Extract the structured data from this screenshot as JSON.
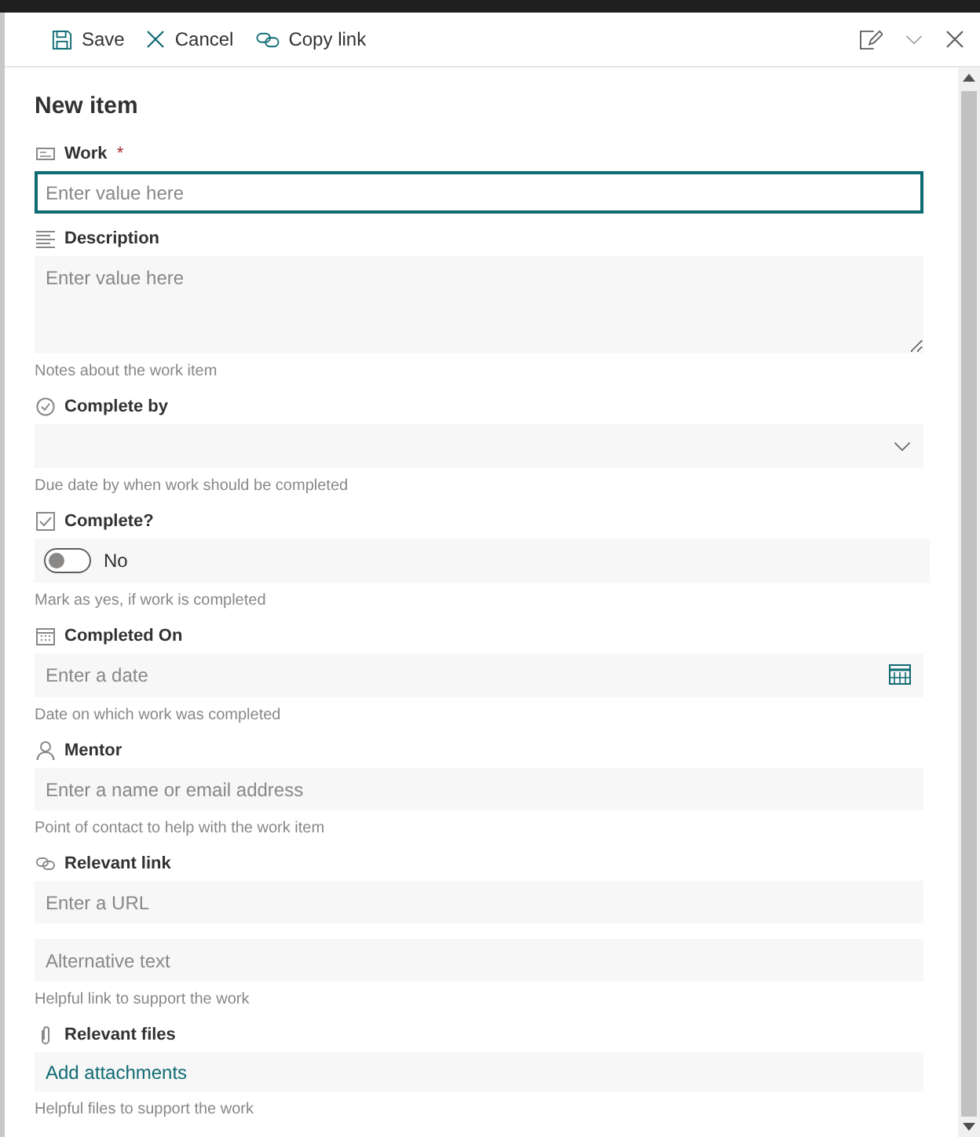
{
  "toolbar": {
    "buttons": [
      {
        "kind": "save",
        "label": "Save"
      },
      {
        "kind": "cancel",
        "label": "Cancel"
      },
      {
        "kind": "copy_link",
        "label": "Copy link"
      }
    ]
  },
  "form": {
    "title": "New item",
    "fields": [
      {
        "kind": "text",
        "label": "Work",
        "required_mark": "*",
        "placeholder": "Enter value here",
        "focused": true
      },
      {
        "kind": "multiline",
        "label": "Description",
        "placeholder": "Enter value here",
        "help": "Notes about the work item"
      },
      {
        "kind": "choice",
        "label": "Complete by",
        "help": "Due date by when work should be completed"
      },
      {
        "kind": "boolean",
        "label": "Complete?",
        "on": false,
        "value": "No",
        "help": "Mark as yes, if work is completed"
      },
      {
        "kind": "date",
        "label": "Completed On",
        "placeholder": "Enter a date",
        "help": "Date on which work was completed"
      },
      {
        "kind": "person",
        "label": "Mentor",
        "placeholder": "Enter a name or email address",
        "help": "Point of contact to help with the work item"
      },
      {
        "kind": "link",
        "label": "Relevant link",
        "placeholder": "Enter a URL",
        "alt_placeholder": "Alternative text",
        "help": "Helpful link to support the work"
      },
      {
        "kind": "attachments",
        "label": "Relevant files",
        "action": "Add attachments",
        "help": "Helpful files to support the work"
      }
    ]
  }
}
